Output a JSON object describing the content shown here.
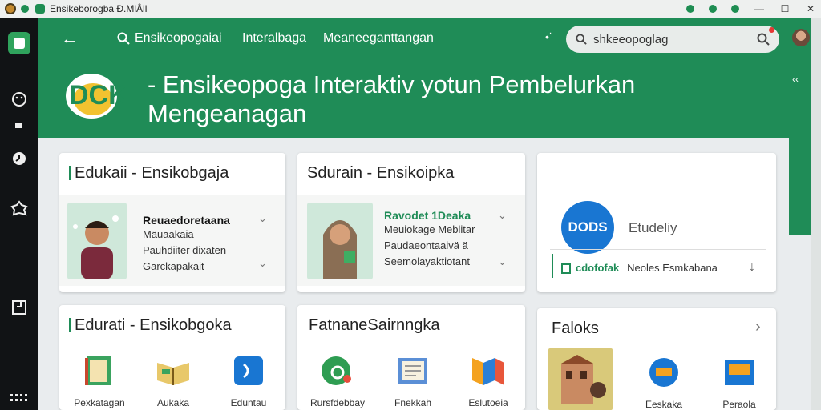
{
  "titlebar": {
    "title": "Ensikeborogba Ð.MlÅll",
    "min": "—",
    "max": "☐",
    "close": "✕"
  },
  "nav": {
    "back": "←",
    "links": [
      "Ensikeopogaiai",
      "Interalbaga",
      "Meaneeganttangan"
    ],
    "dots": "•˙",
    "search_value": "shkeeopoglag"
  },
  "brand": {
    "logo_text": "DCK",
    "title": "- Ensikeopoga Interaktiv yotun Pembelurkan Mengeanagan"
  },
  "cards": {
    "edukasi": {
      "title": "Edukaii - Ensikobgaja",
      "lines": [
        "Reuaedoretaana",
        "Mäuaakaia",
        "Pauhdiiter dixaten",
        "Garckapakait"
      ]
    },
    "sdurain": {
      "title": "Sdurain - Ensikoipka",
      "lines": [
        "Ravodet 1Deaka",
        "Meuiokage Meblitar",
        "Paudaeontaaivä ä",
        "Seemolayaktiotant"
      ]
    },
    "dods": {
      "badge": "DODS",
      "label": "Etudeliy",
      "footer_link": "cdofofak",
      "footer_text": "Neoles Esmkabana",
      "download": "↓"
    },
    "edurati": {
      "title": "Edurati - Ensikobgoka",
      "tiles": [
        "Pexkatagan",
        "Aukaka",
        "Eduntau"
      ]
    },
    "fatnane": {
      "title": "FatnaneSairnngka",
      "tiles": [
        "Rursfdebbay",
        "Fnekkah",
        "Eslutoeia"
      ]
    },
    "faloks": {
      "title": "Faloks",
      "arrow": "›",
      "tiles": [
        "Eeskaka",
        "Peraola"
      ]
    }
  },
  "colors": {
    "brand_green": "#1f8c57",
    "rail_dark": "#111315",
    "accent_blue": "#1976d2"
  }
}
